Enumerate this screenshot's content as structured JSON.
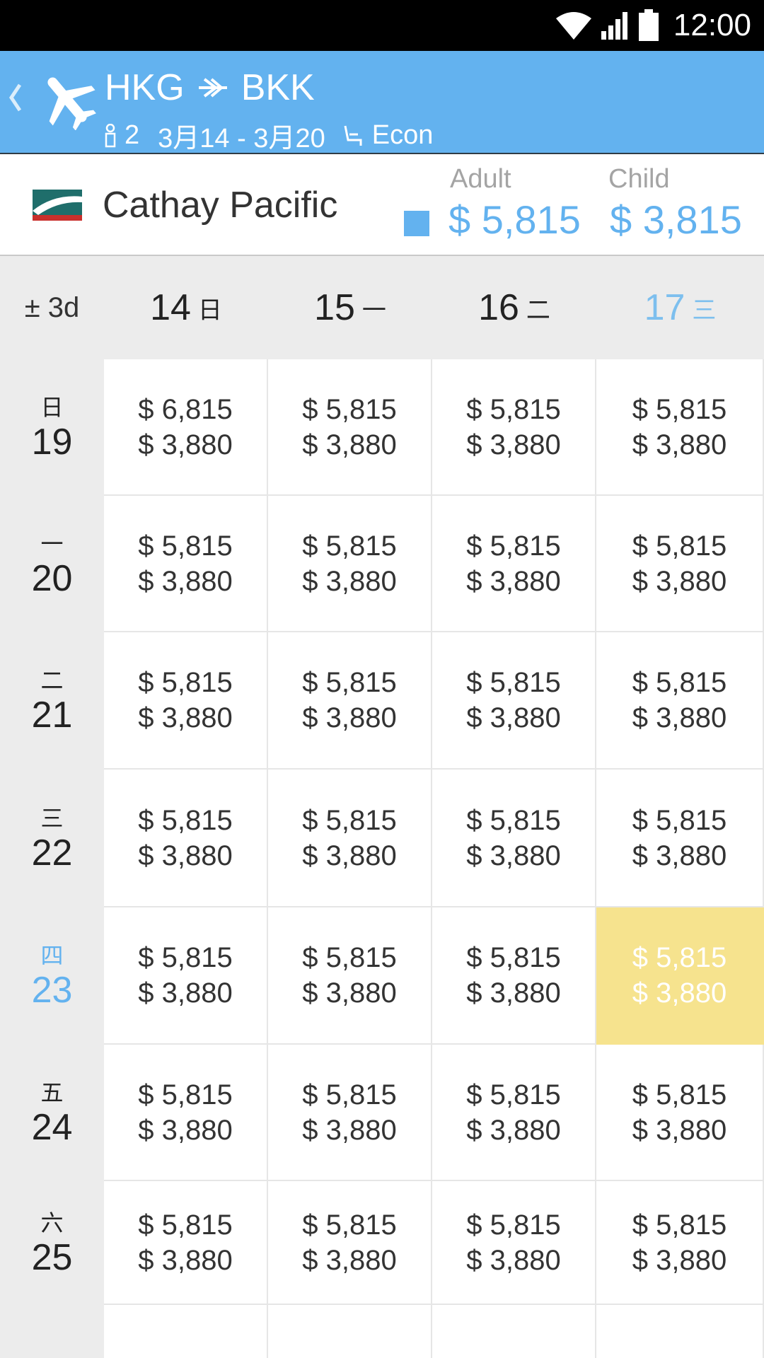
{
  "status_bar": {
    "time": "12:00"
  },
  "header": {
    "origin": "HKG",
    "destination": "BKK",
    "passengers": "2",
    "dates": "3月14 - 3月20",
    "cabin": "Econ"
  },
  "airline": {
    "name": "Cathay Pacific",
    "adult_label": "Adult",
    "adult_price": "$ 5,815",
    "child_label": "Child",
    "child_price": "$ 3,815"
  },
  "grid": {
    "corner_label": "± 3d",
    "columns": [
      {
        "date": "14",
        "dow": "日"
      },
      {
        "date": "15",
        "dow": "一"
      },
      {
        "date": "16",
        "dow": "二"
      },
      {
        "date": "17",
        "dow": "三",
        "selected": true
      }
    ],
    "rows": [
      {
        "date": "19",
        "dow": "日",
        "prices": [
          [
            "$ 6,815",
            "$ 3,880"
          ],
          [
            "$ 5,815",
            "$ 3,880"
          ],
          [
            "$ 5,815",
            "$ 3,880"
          ],
          [
            "$ 5,815",
            "$ 3,880"
          ]
        ]
      },
      {
        "date": "20",
        "dow": "一",
        "prices": [
          [
            "$ 5,815",
            "$ 3,880"
          ],
          [
            "$ 5,815",
            "$ 3,880"
          ],
          [
            "$ 5,815",
            "$ 3,880"
          ],
          [
            "$ 5,815",
            "$ 3,880"
          ]
        ]
      },
      {
        "date": "21",
        "dow": "二",
        "prices": [
          [
            "$ 5,815",
            "$ 3,880"
          ],
          [
            "$ 5,815",
            "$ 3,880"
          ],
          [
            "$ 5,815",
            "$ 3,880"
          ],
          [
            "$ 5,815",
            "$ 3,880"
          ]
        ]
      },
      {
        "date": "22",
        "dow": "三",
        "prices": [
          [
            "$ 5,815",
            "$ 3,880"
          ],
          [
            "$ 5,815",
            "$ 3,880"
          ],
          [
            "$ 5,815",
            "$ 3,880"
          ],
          [
            "$ 5,815",
            "$ 3,880"
          ]
        ]
      },
      {
        "date": "23",
        "dow": "四",
        "selected": true,
        "prices": [
          [
            "$ 5,815",
            "$ 3,880"
          ],
          [
            "$ 5,815",
            "$ 3,880"
          ],
          [
            "$ 5,815",
            "$ 3,880"
          ],
          [
            "$ 5,815",
            "$ 3,880"
          ]
        ]
      },
      {
        "date": "24",
        "dow": "五",
        "prices": [
          [
            "$ 5,815",
            "$ 3,880"
          ],
          [
            "$ 5,815",
            "$ 3,880"
          ],
          [
            "$ 5,815",
            "$ 3,880"
          ],
          [
            "$ 5,815",
            "$ 3,880"
          ]
        ]
      },
      {
        "date": "25",
        "dow": "六",
        "prices": [
          [
            "$ 5,815",
            "$ 3,880"
          ],
          [
            "$ 5,815",
            "$ 3,880"
          ],
          [
            "$ 5,815",
            "$ 3,880"
          ],
          [
            "$ 5,815",
            "$ 3,880"
          ]
        ]
      }
    ],
    "selected_cell": {
      "row": 4,
      "col": 3
    }
  },
  "colors": {
    "accent": "#63b2ef",
    "highlight": "#f6e38e"
  }
}
